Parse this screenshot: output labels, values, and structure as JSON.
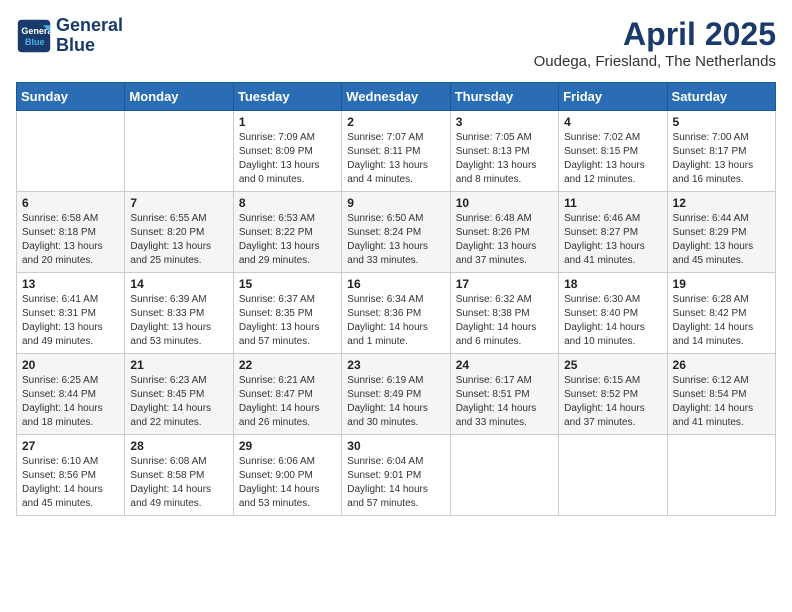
{
  "header": {
    "logo_line1": "General",
    "logo_line2": "Blue",
    "month_year": "April 2025",
    "location": "Oudega, Friesland, The Netherlands"
  },
  "weekdays": [
    "Sunday",
    "Monday",
    "Tuesday",
    "Wednesday",
    "Thursday",
    "Friday",
    "Saturday"
  ],
  "weeks": [
    [
      {
        "day": "",
        "content": ""
      },
      {
        "day": "",
        "content": ""
      },
      {
        "day": "1",
        "content": "Sunrise: 7:09 AM\nSunset: 8:09 PM\nDaylight: 13 hours and 0 minutes."
      },
      {
        "day": "2",
        "content": "Sunrise: 7:07 AM\nSunset: 8:11 PM\nDaylight: 13 hours and 4 minutes."
      },
      {
        "day": "3",
        "content": "Sunrise: 7:05 AM\nSunset: 8:13 PM\nDaylight: 13 hours and 8 minutes."
      },
      {
        "day": "4",
        "content": "Sunrise: 7:02 AM\nSunset: 8:15 PM\nDaylight: 13 hours and 12 minutes."
      },
      {
        "day": "5",
        "content": "Sunrise: 7:00 AM\nSunset: 8:17 PM\nDaylight: 13 hours and 16 minutes."
      }
    ],
    [
      {
        "day": "6",
        "content": "Sunrise: 6:58 AM\nSunset: 8:18 PM\nDaylight: 13 hours and 20 minutes."
      },
      {
        "day": "7",
        "content": "Sunrise: 6:55 AM\nSunset: 8:20 PM\nDaylight: 13 hours and 25 minutes."
      },
      {
        "day": "8",
        "content": "Sunrise: 6:53 AM\nSunset: 8:22 PM\nDaylight: 13 hours and 29 minutes."
      },
      {
        "day": "9",
        "content": "Sunrise: 6:50 AM\nSunset: 8:24 PM\nDaylight: 13 hours and 33 minutes."
      },
      {
        "day": "10",
        "content": "Sunrise: 6:48 AM\nSunset: 8:26 PM\nDaylight: 13 hours and 37 minutes."
      },
      {
        "day": "11",
        "content": "Sunrise: 6:46 AM\nSunset: 8:27 PM\nDaylight: 13 hours and 41 minutes."
      },
      {
        "day": "12",
        "content": "Sunrise: 6:44 AM\nSunset: 8:29 PM\nDaylight: 13 hours and 45 minutes."
      }
    ],
    [
      {
        "day": "13",
        "content": "Sunrise: 6:41 AM\nSunset: 8:31 PM\nDaylight: 13 hours and 49 minutes."
      },
      {
        "day": "14",
        "content": "Sunrise: 6:39 AM\nSunset: 8:33 PM\nDaylight: 13 hours and 53 minutes."
      },
      {
        "day": "15",
        "content": "Sunrise: 6:37 AM\nSunset: 8:35 PM\nDaylight: 13 hours and 57 minutes."
      },
      {
        "day": "16",
        "content": "Sunrise: 6:34 AM\nSunset: 8:36 PM\nDaylight: 14 hours and 1 minute."
      },
      {
        "day": "17",
        "content": "Sunrise: 6:32 AM\nSunset: 8:38 PM\nDaylight: 14 hours and 6 minutes."
      },
      {
        "day": "18",
        "content": "Sunrise: 6:30 AM\nSunset: 8:40 PM\nDaylight: 14 hours and 10 minutes."
      },
      {
        "day": "19",
        "content": "Sunrise: 6:28 AM\nSunset: 8:42 PM\nDaylight: 14 hours and 14 minutes."
      }
    ],
    [
      {
        "day": "20",
        "content": "Sunrise: 6:25 AM\nSunset: 8:44 PM\nDaylight: 14 hours and 18 minutes."
      },
      {
        "day": "21",
        "content": "Sunrise: 6:23 AM\nSunset: 8:45 PM\nDaylight: 14 hours and 22 minutes."
      },
      {
        "day": "22",
        "content": "Sunrise: 6:21 AM\nSunset: 8:47 PM\nDaylight: 14 hours and 26 minutes."
      },
      {
        "day": "23",
        "content": "Sunrise: 6:19 AM\nSunset: 8:49 PM\nDaylight: 14 hours and 30 minutes."
      },
      {
        "day": "24",
        "content": "Sunrise: 6:17 AM\nSunset: 8:51 PM\nDaylight: 14 hours and 33 minutes."
      },
      {
        "day": "25",
        "content": "Sunrise: 6:15 AM\nSunset: 8:52 PM\nDaylight: 14 hours and 37 minutes."
      },
      {
        "day": "26",
        "content": "Sunrise: 6:12 AM\nSunset: 8:54 PM\nDaylight: 14 hours and 41 minutes."
      }
    ],
    [
      {
        "day": "27",
        "content": "Sunrise: 6:10 AM\nSunset: 8:56 PM\nDaylight: 14 hours and 45 minutes."
      },
      {
        "day": "28",
        "content": "Sunrise: 6:08 AM\nSunset: 8:58 PM\nDaylight: 14 hours and 49 minutes."
      },
      {
        "day": "29",
        "content": "Sunrise: 6:06 AM\nSunset: 9:00 PM\nDaylight: 14 hours and 53 minutes."
      },
      {
        "day": "30",
        "content": "Sunrise: 6:04 AM\nSunset: 9:01 PM\nDaylight: 14 hours and 57 minutes."
      },
      {
        "day": "",
        "content": ""
      },
      {
        "day": "",
        "content": ""
      },
      {
        "day": "",
        "content": ""
      }
    ]
  ]
}
